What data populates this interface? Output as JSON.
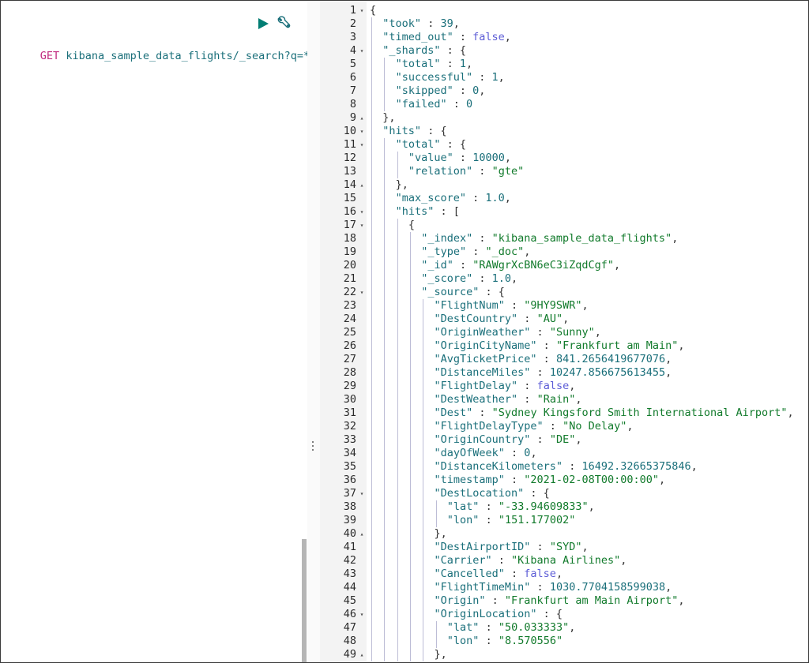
{
  "request": {
    "method": "GET",
    "url": "kibana_sample_data_flights/_search?q=*"
  },
  "response_lines": [
    {
      "n": "1",
      "fold": "open",
      "indent": 0,
      "tokens": [
        {
          "t": "p",
          "v": "{"
        }
      ]
    },
    {
      "n": "2",
      "indent": 1,
      "tokens": [
        {
          "t": "k",
          "v": "\"took\""
        },
        {
          "t": "p",
          "v": " : "
        },
        {
          "t": "n",
          "v": "39"
        },
        {
          "t": "p",
          "v": ","
        }
      ]
    },
    {
      "n": "3",
      "indent": 1,
      "tokens": [
        {
          "t": "k",
          "v": "\"timed_out\""
        },
        {
          "t": "p",
          "v": " : "
        },
        {
          "t": "b",
          "v": "false"
        },
        {
          "t": "p",
          "v": ","
        }
      ]
    },
    {
      "n": "4",
      "fold": "open",
      "indent": 1,
      "tokens": [
        {
          "t": "k",
          "v": "\"_shards\""
        },
        {
          "t": "p",
          "v": " : {"
        }
      ]
    },
    {
      "n": "5",
      "indent": 2,
      "tokens": [
        {
          "t": "k",
          "v": "\"total\""
        },
        {
          "t": "p",
          "v": " : "
        },
        {
          "t": "n",
          "v": "1"
        },
        {
          "t": "p",
          "v": ","
        }
      ]
    },
    {
      "n": "6",
      "indent": 2,
      "tokens": [
        {
          "t": "k",
          "v": "\"successful\""
        },
        {
          "t": "p",
          "v": " : "
        },
        {
          "t": "n",
          "v": "1"
        },
        {
          "t": "p",
          "v": ","
        }
      ]
    },
    {
      "n": "7",
      "indent": 2,
      "tokens": [
        {
          "t": "k",
          "v": "\"skipped\""
        },
        {
          "t": "p",
          "v": " : "
        },
        {
          "t": "n",
          "v": "0"
        },
        {
          "t": "p",
          "v": ","
        }
      ]
    },
    {
      "n": "8",
      "indent": 2,
      "tokens": [
        {
          "t": "k",
          "v": "\"failed\""
        },
        {
          "t": "p",
          "v": " : "
        },
        {
          "t": "n",
          "v": "0"
        }
      ]
    },
    {
      "n": "9",
      "fold": "close",
      "indent": 1,
      "tokens": [
        {
          "t": "p",
          "v": "},"
        }
      ]
    },
    {
      "n": "10",
      "fold": "open",
      "indent": 1,
      "tokens": [
        {
          "t": "k",
          "v": "\"hits\""
        },
        {
          "t": "p",
          "v": " : {"
        }
      ]
    },
    {
      "n": "11",
      "fold": "open",
      "indent": 2,
      "tokens": [
        {
          "t": "k",
          "v": "\"total\""
        },
        {
          "t": "p",
          "v": " : {"
        }
      ]
    },
    {
      "n": "12",
      "indent": 3,
      "tokens": [
        {
          "t": "k",
          "v": "\"value\""
        },
        {
          "t": "p",
          "v": " : "
        },
        {
          "t": "n",
          "v": "10000"
        },
        {
          "t": "p",
          "v": ","
        }
      ]
    },
    {
      "n": "13",
      "indent": 3,
      "tokens": [
        {
          "t": "k",
          "v": "\"relation\""
        },
        {
          "t": "p",
          "v": " : "
        },
        {
          "t": "s",
          "v": "\"gte\""
        }
      ]
    },
    {
      "n": "14",
      "fold": "close",
      "indent": 2,
      "tokens": [
        {
          "t": "p",
          "v": "},"
        }
      ]
    },
    {
      "n": "15",
      "indent": 2,
      "tokens": [
        {
          "t": "k",
          "v": "\"max_score\""
        },
        {
          "t": "p",
          "v": " : "
        },
        {
          "t": "n",
          "v": "1.0"
        },
        {
          "t": "p",
          "v": ","
        }
      ]
    },
    {
      "n": "16",
      "fold": "open",
      "indent": 2,
      "tokens": [
        {
          "t": "k",
          "v": "\"hits\""
        },
        {
          "t": "p",
          "v": " : ["
        }
      ]
    },
    {
      "n": "17",
      "fold": "open",
      "indent": 3,
      "tokens": [
        {
          "t": "p",
          "v": "{"
        }
      ]
    },
    {
      "n": "18",
      "indent": 4,
      "tokens": [
        {
          "t": "k",
          "v": "\"_index\""
        },
        {
          "t": "p",
          "v": " : "
        },
        {
          "t": "s",
          "v": "\"kibana_sample_data_flights\""
        },
        {
          "t": "p",
          "v": ","
        }
      ]
    },
    {
      "n": "19",
      "indent": 4,
      "tokens": [
        {
          "t": "k",
          "v": "\"_type\""
        },
        {
          "t": "p",
          "v": " : "
        },
        {
          "t": "s",
          "v": "\"_doc\""
        },
        {
          "t": "p",
          "v": ","
        }
      ]
    },
    {
      "n": "20",
      "indent": 4,
      "tokens": [
        {
          "t": "k",
          "v": "\"_id\""
        },
        {
          "t": "p",
          "v": " : "
        },
        {
          "t": "s",
          "v": "\"RAWgrXcBN6eC3iZqdCgf\""
        },
        {
          "t": "p",
          "v": ","
        }
      ]
    },
    {
      "n": "21",
      "indent": 4,
      "tokens": [
        {
          "t": "k",
          "v": "\"_score\""
        },
        {
          "t": "p",
          "v": " : "
        },
        {
          "t": "n",
          "v": "1.0"
        },
        {
          "t": "p",
          "v": ","
        }
      ]
    },
    {
      "n": "22",
      "fold": "open",
      "indent": 4,
      "tokens": [
        {
          "t": "k",
          "v": "\"_source\""
        },
        {
          "t": "p",
          "v": " : {"
        }
      ]
    },
    {
      "n": "23",
      "indent": 5,
      "tokens": [
        {
          "t": "k",
          "v": "\"FlightNum\""
        },
        {
          "t": "p",
          "v": " : "
        },
        {
          "t": "s",
          "v": "\"9HY9SWR\""
        },
        {
          "t": "p",
          "v": ","
        }
      ]
    },
    {
      "n": "24",
      "indent": 5,
      "tokens": [
        {
          "t": "k",
          "v": "\"DestCountry\""
        },
        {
          "t": "p",
          "v": " : "
        },
        {
          "t": "s",
          "v": "\"AU\""
        },
        {
          "t": "p",
          "v": ","
        }
      ]
    },
    {
      "n": "25",
      "indent": 5,
      "tokens": [
        {
          "t": "k",
          "v": "\"OriginWeather\""
        },
        {
          "t": "p",
          "v": " : "
        },
        {
          "t": "s",
          "v": "\"Sunny\""
        },
        {
          "t": "p",
          "v": ","
        }
      ]
    },
    {
      "n": "26",
      "indent": 5,
      "tokens": [
        {
          "t": "k",
          "v": "\"OriginCityName\""
        },
        {
          "t": "p",
          "v": " : "
        },
        {
          "t": "s",
          "v": "\"Frankfurt am Main\""
        },
        {
          "t": "p",
          "v": ","
        }
      ]
    },
    {
      "n": "27",
      "indent": 5,
      "tokens": [
        {
          "t": "k",
          "v": "\"AvgTicketPrice\""
        },
        {
          "t": "p",
          "v": " : "
        },
        {
          "t": "n",
          "v": "841.2656419677076"
        },
        {
          "t": "p",
          "v": ","
        }
      ]
    },
    {
      "n": "28",
      "indent": 5,
      "tokens": [
        {
          "t": "k",
          "v": "\"DistanceMiles\""
        },
        {
          "t": "p",
          "v": " : "
        },
        {
          "t": "n",
          "v": "10247.856675613455"
        },
        {
          "t": "p",
          "v": ","
        }
      ]
    },
    {
      "n": "29",
      "indent": 5,
      "tokens": [
        {
          "t": "k",
          "v": "\"FlightDelay\""
        },
        {
          "t": "p",
          "v": " : "
        },
        {
          "t": "b",
          "v": "false"
        },
        {
          "t": "p",
          "v": ","
        }
      ]
    },
    {
      "n": "30",
      "indent": 5,
      "tokens": [
        {
          "t": "k",
          "v": "\"DestWeather\""
        },
        {
          "t": "p",
          "v": " : "
        },
        {
          "t": "s",
          "v": "\"Rain\""
        },
        {
          "t": "p",
          "v": ","
        }
      ]
    },
    {
      "n": "31",
      "indent": 5,
      "tokens": [
        {
          "t": "k",
          "v": "\"Dest\""
        },
        {
          "t": "p",
          "v": " : "
        },
        {
          "t": "s",
          "v": "\"Sydney Kingsford Smith International Airport\""
        },
        {
          "t": "p",
          "v": ","
        }
      ]
    },
    {
      "n": "32",
      "indent": 5,
      "tokens": [
        {
          "t": "k",
          "v": "\"FlightDelayType\""
        },
        {
          "t": "p",
          "v": " : "
        },
        {
          "t": "s",
          "v": "\"No Delay\""
        },
        {
          "t": "p",
          "v": ","
        }
      ]
    },
    {
      "n": "33",
      "indent": 5,
      "tokens": [
        {
          "t": "k",
          "v": "\"OriginCountry\""
        },
        {
          "t": "p",
          "v": " : "
        },
        {
          "t": "s",
          "v": "\"DE\""
        },
        {
          "t": "p",
          "v": ","
        }
      ]
    },
    {
      "n": "34",
      "indent": 5,
      "tokens": [
        {
          "t": "k",
          "v": "\"dayOfWeek\""
        },
        {
          "t": "p",
          "v": " : "
        },
        {
          "t": "n",
          "v": "0"
        },
        {
          "t": "p",
          "v": ","
        }
      ]
    },
    {
      "n": "35",
      "indent": 5,
      "tokens": [
        {
          "t": "k",
          "v": "\"DistanceKilometers\""
        },
        {
          "t": "p",
          "v": " : "
        },
        {
          "t": "n",
          "v": "16492.32665375846"
        },
        {
          "t": "p",
          "v": ","
        }
      ]
    },
    {
      "n": "36",
      "indent": 5,
      "tokens": [
        {
          "t": "k",
          "v": "\"timestamp\""
        },
        {
          "t": "p",
          "v": " : "
        },
        {
          "t": "s",
          "v": "\"2021-02-08T00:00:00\""
        },
        {
          "t": "p",
          "v": ","
        }
      ]
    },
    {
      "n": "37",
      "fold": "open",
      "indent": 5,
      "tokens": [
        {
          "t": "k",
          "v": "\"DestLocation\""
        },
        {
          "t": "p",
          "v": " : {"
        }
      ]
    },
    {
      "n": "38",
      "indent": 6,
      "tokens": [
        {
          "t": "k",
          "v": "\"lat\""
        },
        {
          "t": "p",
          "v": " : "
        },
        {
          "t": "s",
          "v": "\"-33.94609833\""
        },
        {
          "t": "p",
          "v": ","
        }
      ]
    },
    {
      "n": "39",
      "indent": 6,
      "tokens": [
        {
          "t": "k",
          "v": "\"lon\""
        },
        {
          "t": "p",
          "v": " : "
        },
        {
          "t": "s",
          "v": "\"151.177002\""
        }
      ]
    },
    {
      "n": "40",
      "fold": "close",
      "indent": 5,
      "tokens": [
        {
          "t": "p",
          "v": "},"
        }
      ]
    },
    {
      "n": "41",
      "indent": 5,
      "tokens": [
        {
          "t": "k",
          "v": "\"DestAirportID\""
        },
        {
          "t": "p",
          "v": " : "
        },
        {
          "t": "s",
          "v": "\"SYD\""
        },
        {
          "t": "p",
          "v": ","
        }
      ]
    },
    {
      "n": "42",
      "indent": 5,
      "tokens": [
        {
          "t": "k",
          "v": "\"Carrier\""
        },
        {
          "t": "p",
          "v": " : "
        },
        {
          "t": "s",
          "v": "\"Kibana Airlines\""
        },
        {
          "t": "p",
          "v": ","
        }
      ]
    },
    {
      "n": "43",
      "indent": 5,
      "tokens": [
        {
          "t": "k",
          "v": "\"Cancelled\""
        },
        {
          "t": "p",
          "v": " : "
        },
        {
          "t": "b",
          "v": "false"
        },
        {
          "t": "p",
          "v": ","
        }
      ]
    },
    {
      "n": "44",
      "indent": 5,
      "tokens": [
        {
          "t": "k",
          "v": "\"FlightTimeMin\""
        },
        {
          "t": "p",
          "v": " : "
        },
        {
          "t": "n",
          "v": "1030.7704158599038"
        },
        {
          "t": "p",
          "v": ","
        }
      ]
    },
    {
      "n": "45",
      "indent": 5,
      "tokens": [
        {
          "t": "k",
          "v": "\"Origin\""
        },
        {
          "t": "p",
          "v": " : "
        },
        {
          "t": "s",
          "v": "\"Frankfurt am Main Airport\""
        },
        {
          "t": "p",
          "v": ","
        }
      ]
    },
    {
      "n": "46",
      "fold": "open",
      "indent": 5,
      "tokens": [
        {
          "t": "k",
          "v": "\"OriginLocation\""
        },
        {
          "t": "p",
          "v": " : {"
        }
      ]
    },
    {
      "n": "47",
      "indent": 6,
      "tokens": [
        {
          "t": "k",
          "v": "\"lat\""
        },
        {
          "t": "p",
          "v": " : "
        },
        {
          "t": "s",
          "v": "\"50.033333\""
        },
        {
          "t": "p",
          "v": ","
        }
      ]
    },
    {
      "n": "48",
      "indent": 6,
      "tokens": [
        {
          "t": "k",
          "v": "\"lon\""
        },
        {
          "t": "p",
          "v": " : "
        },
        {
          "t": "s",
          "v": "\"8.570556\""
        }
      ]
    },
    {
      "n": "49",
      "fold": "close",
      "indent": 5,
      "tokens": [
        {
          "t": "p",
          "v": "},"
        }
      ]
    }
  ],
  "icons": {
    "run": "play-icon",
    "settings": "wrench-icon",
    "splitter": "vertical-dots-icon"
  },
  "colors": {
    "method": "#c12b7f",
    "url": "#1a6f7a",
    "key": "#1a6f7a",
    "string": "#117a2b",
    "number": "#1a6f7a",
    "boolean": "#5c5cd6",
    "run_button": "#017d73",
    "gutter": "#f3f3f3"
  }
}
